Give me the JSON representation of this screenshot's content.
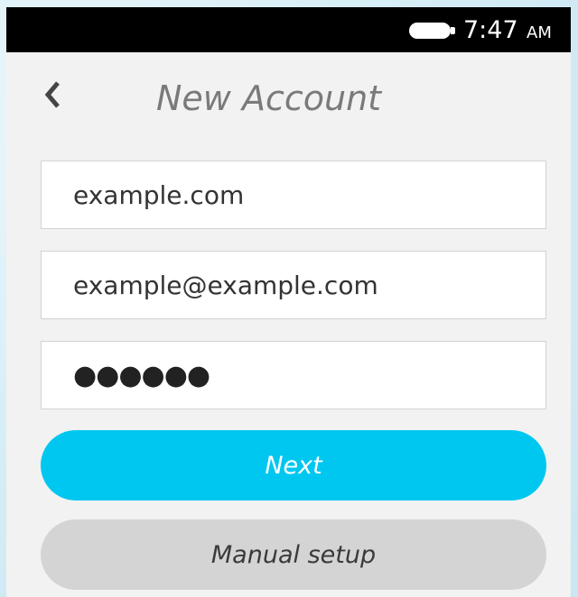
{
  "status_bar": {
    "time": "7:47",
    "ampm": "AM"
  },
  "header": {
    "title": "New Account"
  },
  "form": {
    "domain_value": "example.com",
    "email_value": "example@example.com",
    "password_mask": "●●●●●●"
  },
  "buttons": {
    "next_label": "Next",
    "manual_label": "Manual setup"
  },
  "colors": {
    "accent": "#00c7f0",
    "secondary": "#d4d4d4",
    "status_bar": "#000000",
    "background": "#f2f2f2"
  }
}
